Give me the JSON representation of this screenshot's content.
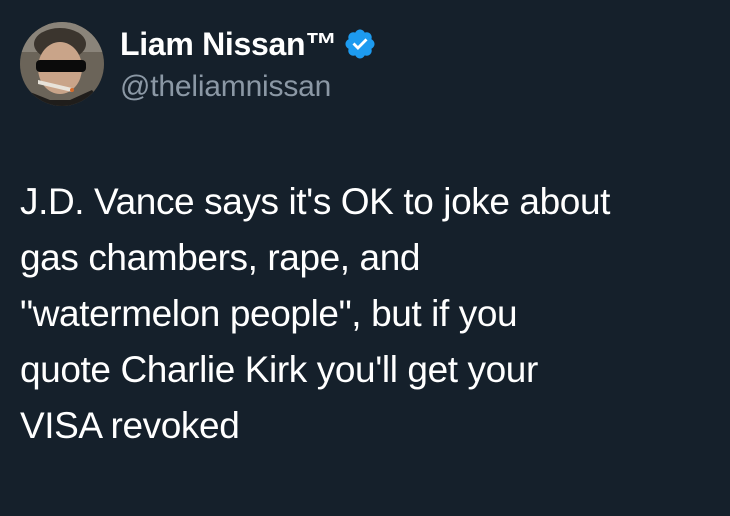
{
  "author": {
    "display_name": "Liam Nissan™",
    "handle": "@theliamnissan",
    "verified_icon": "verified-badge-icon",
    "avatar_icon": "avatar-photo"
  },
  "tweet": {
    "text": "J.D. Vance says it's OK to joke about\ngas chambers, rape, and\n\"watermelon people\", but if you\nquote Charlie Kirk you'll get your\nVISA revoked"
  },
  "colors": {
    "background": "#15202b",
    "text_primary": "#ffffff",
    "text_secondary": "#8b98a5",
    "verified_blue": "#1d9bf0"
  }
}
